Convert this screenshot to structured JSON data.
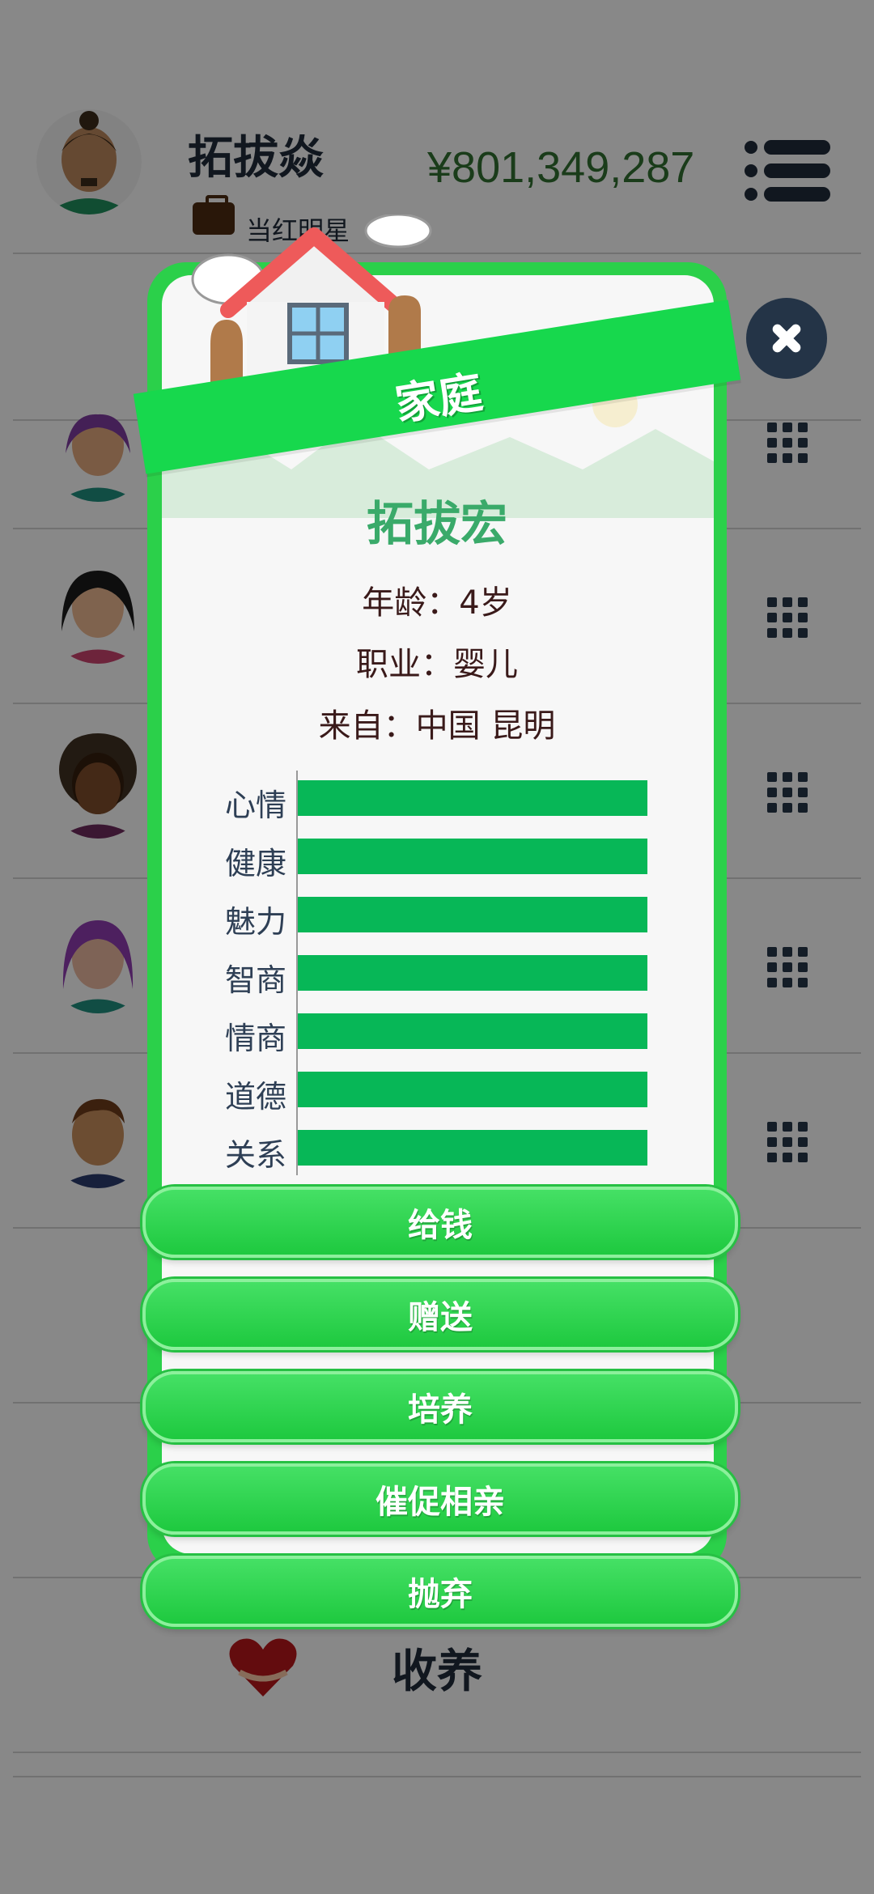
{
  "header": {
    "name": "拓拔焱",
    "money": "¥801,349,287",
    "occupation": "当红明星"
  },
  "modal": {
    "title": "家庭",
    "child_name": "拓拔宏",
    "age": "年龄：4岁",
    "job": "职业：婴儿",
    "from": "来自：中国 昆明",
    "stats": [
      {
        "label": "心情",
        "value": 1.0
      },
      {
        "label": "健康",
        "value": 1.0
      },
      {
        "label": "魅力",
        "value": 1.0
      },
      {
        "label": "智商",
        "value": 1.0
      },
      {
        "label": "情商",
        "value": 1.0
      },
      {
        "label": "道德",
        "value": 1.0
      },
      {
        "label": "关系",
        "value": 1.0
      }
    ],
    "actions": [
      "给钱",
      "赠送",
      "培养",
      "催促相亲",
      "抛弃"
    ]
  },
  "list": {
    "adopt_label": "收养"
  },
  "colors": {
    "accent": "#17d84d",
    "bar": "#07b757",
    "name": "#3aaa6a",
    "dark": "#243447"
  }
}
